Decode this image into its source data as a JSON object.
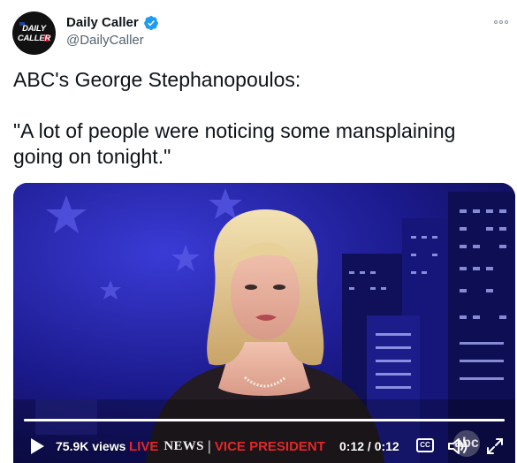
{
  "author": {
    "avatar_text": [
      "DAILY",
      "CALLER"
    ],
    "display_name": "Daily Caller",
    "handle": "@DailyCaller",
    "verified": true
  },
  "more_icon": "more-options-icon",
  "tweet": {
    "lines": [
      "ABC's George Stephanopoulos:",
      "\"A lot of people were noticing some mansplaining going on tonight.\""
    ]
  },
  "video": {
    "views_label": "75.9K views",
    "progress_fraction": 1.0,
    "time_label": "0:12 / 0:12",
    "cc_label": "CC",
    "watermark": "abc",
    "lower_third": {
      "live": "LIVE",
      "network": "NEWS",
      "separator": "|",
      "headline": "VICE PRESIDENT"
    },
    "icons": {
      "play": "play-icon",
      "volume": "volume-icon",
      "fullscreen": "fullscreen-icon",
      "captions": "closed-captions-icon"
    }
  },
  "colors": {
    "verified_blue": "#1d9bf0",
    "handle_gray": "#536471",
    "abc_red": "#e32727"
  }
}
